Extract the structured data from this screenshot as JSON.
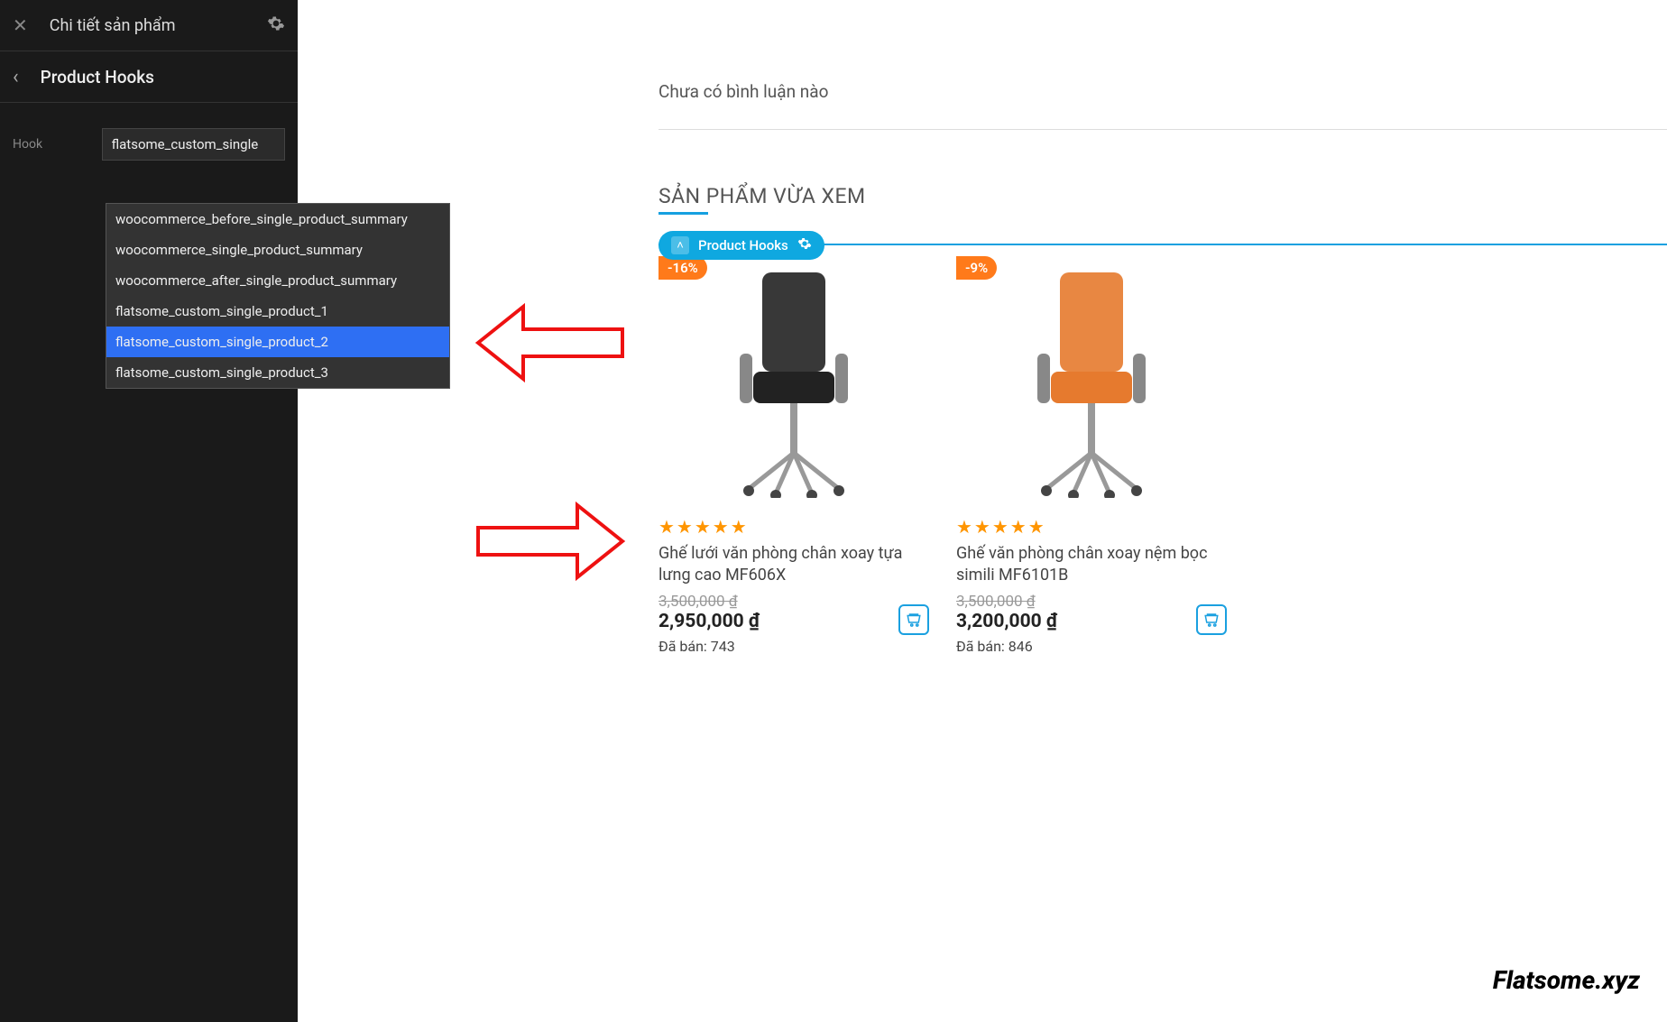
{
  "sidebar": {
    "close_label": "✕",
    "title": "Chi tiết sản phẩm",
    "back": "‹",
    "sub_title": "Product Hooks",
    "hook_label": "Hook",
    "hook_value": "flatsome_custom_single"
  },
  "dropdown": {
    "items": [
      "woocommerce_before_single_product_summary",
      "woocommerce_single_product_summary",
      "woocommerce_after_single_product_summary",
      "flatsome_custom_single_product_1",
      "flatsome_custom_single_product_2",
      "flatsome_custom_single_product_3"
    ],
    "selected_index": 4
  },
  "preview": {
    "comment_note": "Chưa có bình luận nào",
    "section_title": "SẢN PHẨM VỪA XEM",
    "badge": {
      "chevron": "˄",
      "label": "Product Hooks"
    },
    "products": [
      {
        "discount": "-16%",
        "name": "Ghế lưới văn phòng chân xoay tựa lưng cao MF606X",
        "old_price": "3,500,000 ₫",
        "new_price": "2,950,000 ₫",
        "sold": "Đã bán: 743",
        "chair_color": "#222"
      },
      {
        "discount": "-9%",
        "name": "Ghế văn phòng chân xoay nệm bọc simili MF6101B",
        "old_price": "3,500,000 ₫",
        "new_price": "3,200,000 ₫",
        "sold": "Đã bán: 846",
        "chair_color": "#e67a2e"
      }
    ],
    "watermark": "Flatsome.xyz"
  }
}
